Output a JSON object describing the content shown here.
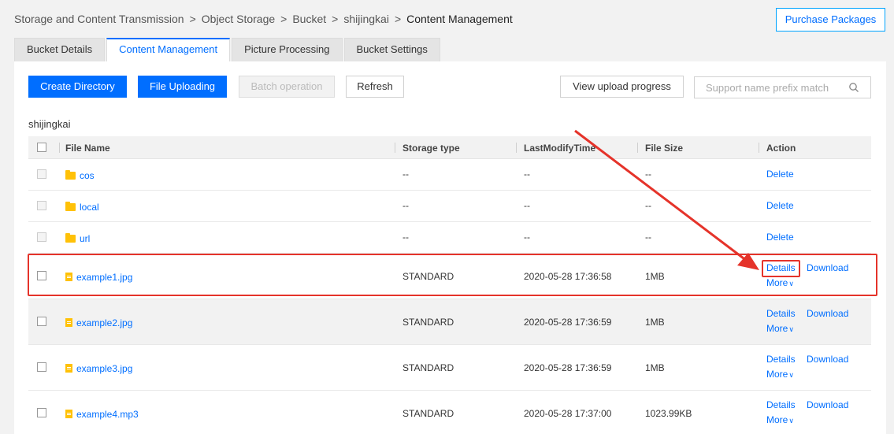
{
  "breadcrumb": {
    "items": [
      "Storage and Content Transmission",
      "Object Storage",
      "Bucket",
      "shijingkai"
    ],
    "current": "Content Management",
    "separator": ">"
  },
  "header": {
    "purchase_label": "Purchase Packages"
  },
  "tabs": [
    {
      "label": "Bucket Details",
      "active": false
    },
    {
      "label": "Content Management",
      "active": true
    },
    {
      "label": "Picture Processing",
      "active": false
    },
    {
      "label": "Bucket Settings",
      "active": false
    }
  ],
  "toolbar": {
    "create_dir": "Create Directory",
    "upload": "File Uploading",
    "batch": "Batch operation",
    "refresh": "Refresh",
    "upload_progress": "View upload progress",
    "search_placeholder": "Support name prefix match"
  },
  "path": "shijingkai",
  "table": {
    "columns": [
      "File Name",
      "Storage type",
      "LastModifyTime",
      "File Size",
      "Action"
    ],
    "folders": [
      {
        "name": "cos",
        "storage": "--",
        "time": "--",
        "size": "--",
        "action": "Delete"
      },
      {
        "name": "local",
        "storage": "--",
        "time": "--",
        "size": "--",
        "action": "Delete"
      },
      {
        "name": "url",
        "storage": "--",
        "time": "--",
        "size": "--",
        "action": "Delete"
      }
    ],
    "files": [
      {
        "name": "example1.jpg",
        "storage": "STANDARD",
        "time": "2020-05-28 17:36:58",
        "size": "1MB"
      },
      {
        "name": "example2.jpg",
        "storage": "STANDARD",
        "time": "2020-05-28 17:36:59",
        "size": "1MB"
      },
      {
        "name": "example3.jpg",
        "storage": "STANDARD",
        "time": "2020-05-28 17:36:59",
        "size": "1MB"
      },
      {
        "name": "example4.mp3",
        "storage": "STANDARD",
        "time": "2020-05-28 17:37:00",
        "size": "1023.99KB"
      }
    ],
    "file_actions": {
      "details": "Details",
      "download": "Download",
      "more": "More"
    }
  },
  "colors": {
    "accent": "#006eff",
    "annotation": "#e5332a",
    "folder": "#ffc107"
  },
  "icons": {
    "search": "search-icon",
    "folder": "folder-icon",
    "file": "file-icon",
    "chevron": "chevron-down-icon"
  }
}
